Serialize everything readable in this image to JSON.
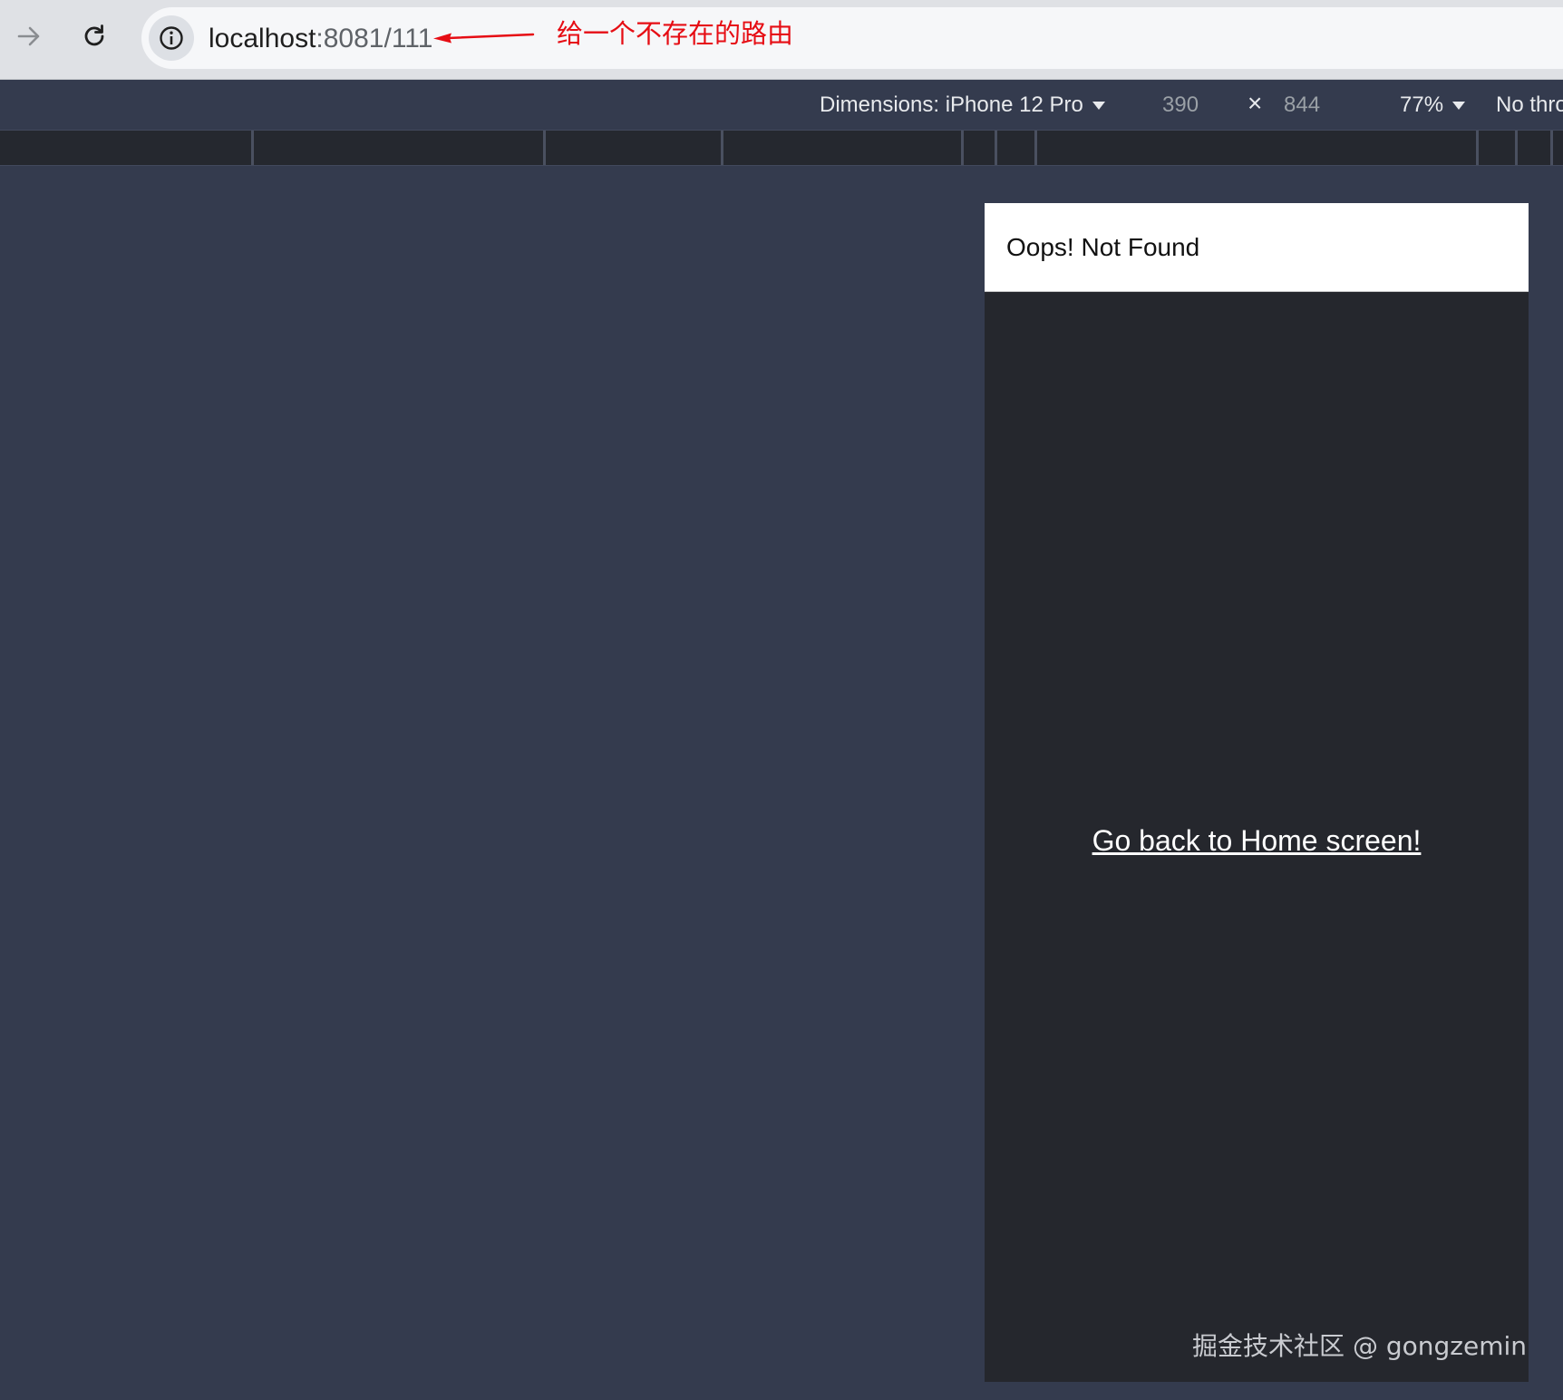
{
  "browser": {
    "url_host": "localhost",
    "url_rest": ":8081/111",
    "annotation": "给一个不存在的路由",
    "colors": {
      "annotation": "#e60d14",
      "toolbar": "#dfe1e5"
    },
    "icons": {
      "forward": "forward-arrow-icon",
      "reload": "reload-icon",
      "info": "info-icon"
    }
  },
  "devtools": {
    "dimensions_label": "Dimensions: iPhone 12 Pro",
    "width": "390",
    "times": "×",
    "height": "844",
    "zoom": "77%",
    "throttle": "No thro"
  },
  "page": {
    "title": "Oops! Not Found",
    "link": "Go back to Home screen!"
  },
  "watermark": "掘金技术社区 @ gongzemin"
}
